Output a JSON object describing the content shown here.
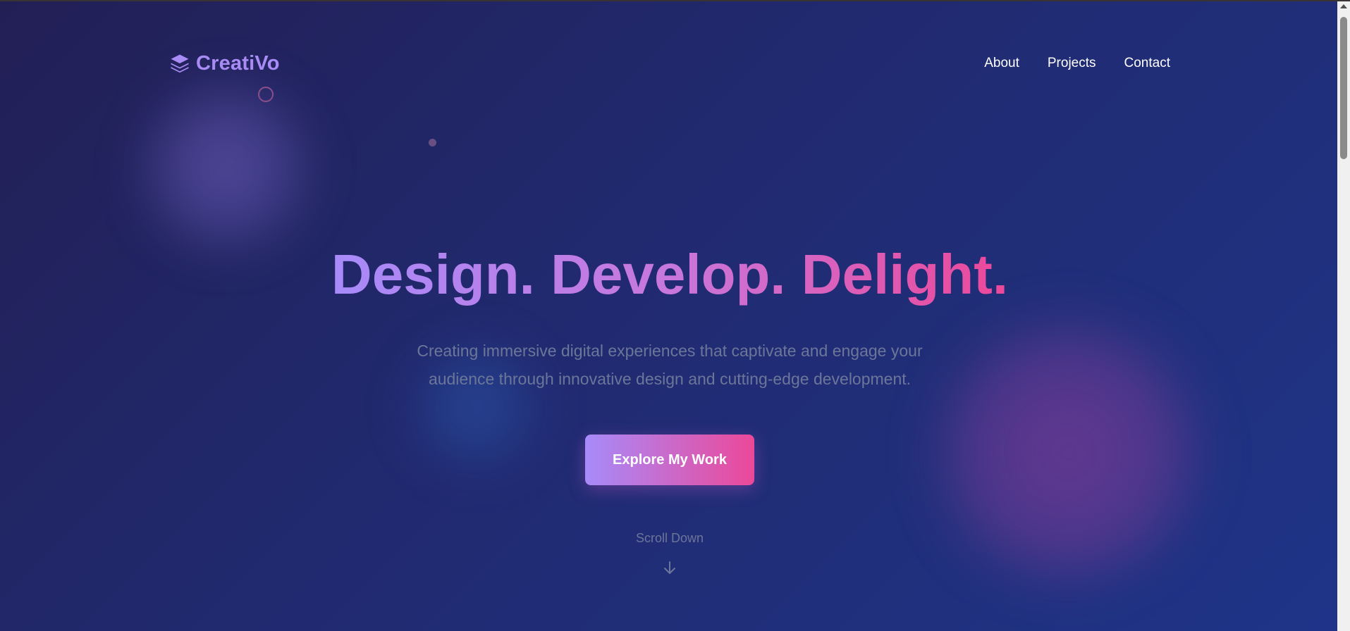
{
  "brand": {
    "name": "CreatiVo",
    "icon": "layers-icon"
  },
  "nav": {
    "items": [
      {
        "label": "About"
      },
      {
        "label": "Projects"
      },
      {
        "label": "Contact"
      }
    ]
  },
  "hero": {
    "title": "Design. Develop. Delight.",
    "subtitle": "Creating immersive digital experiences that captivate and engage your audience through innovative design and cutting-edge development.",
    "cta_label": "Explore My Work",
    "scroll_label": "Scroll Down",
    "scroll_icon": "arrow-down-icon"
  },
  "colors": {
    "accent_purple": "#a78bfa",
    "accent_pink": "#ec4899",
    "background_start": "#221f55",
    "background_end": "#1f3488",
    "muted_text": "#6b7699"
  }
}
